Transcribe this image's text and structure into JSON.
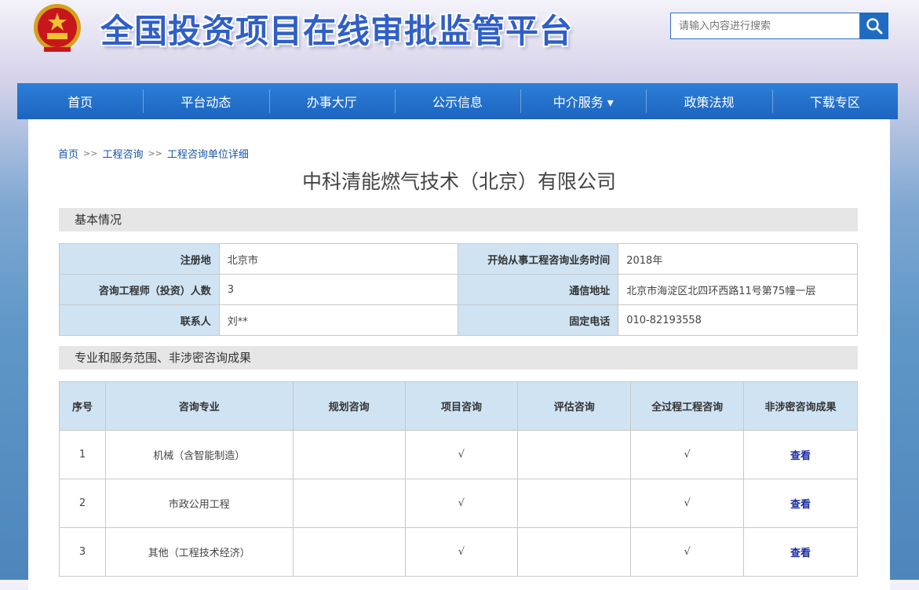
{
  "header": {
    "site_title": "全国投资项目在线审批监管平台",
    "search_placeholder": "请输入内容进行搜索"
  },
  "nav": {
    "items": [
      "首页",
      "平台动态",
      "办事大厅",
      "公示信息",
      "中介服务 ▾",
      "政策法规",
      "下载专区"
    ]
  },
  "breadcrumb": [
    "首页",
    "工程咨询",
    "工程咨询单位详细"
  ],
  "breadcrumb_sep": ">>",
  "company_name": "中科清能燃气技术（北京）有限公司",
  "basic": {
    "section_title": "基本情况",
    "rows": [
      {
        "label1": "注册地",
        "value1": "北京市",
        "label2": "开始从事工程咨询业务时间",
        "value2": "2018年"
      },
      {
        "label1": "咨询工程师（投资）人数",
        "value1": "3",
        "label2": "通信地址",
        "value2": "北京市海淀区北四环西路11号第75幢一层"
      },
      {
        "label1": "联系人",
        "value1": "刘**",
        "label2": "固定电话",
        "value2": "010-82193558"
      }
    ]
  },
  "services": {
    "section_title": "专业和服务范围、非涉密咨询成果",
    "headers": [
      "序号",
      "咨询专业",
      "规划咨询",
      "项目咨询",
      "评估咨询",
      "全过程工程咨询",
      "非涉密咨询成果"
    ],
    "rows": [
      {
        "no": "1",
        "major": "机械（含智能制造）",
        "plan": "",
        "project": "√",
        "assess": "",
        "whole": "√",
        "result": "查看"
      },
      {
        "no": "2",
        "major": "市政公用工程",
        "plan": "",
        "project": "√",
        "assess": "",
        "whole": "√",
        "result": "查看"
      },
      {
        "no": "3",
        "major": "其他（工程技术经济）",
        "plan": "",
        "project": "√",
        "assess": "",
        "whole": "√",
        "result": "查看"
      }
    ]
  },
  "colors": {
    "nav_blue": "#1d64c0",
    "title_blue": "#2f5fc7",
    "label_bg": "#cfe3f3",
    "link_dark_blue": "#1d2ea0"
  },
  "icons": {
    "emblem": "national-emblem-icon",
    "search": "search-icon"
  }
}
